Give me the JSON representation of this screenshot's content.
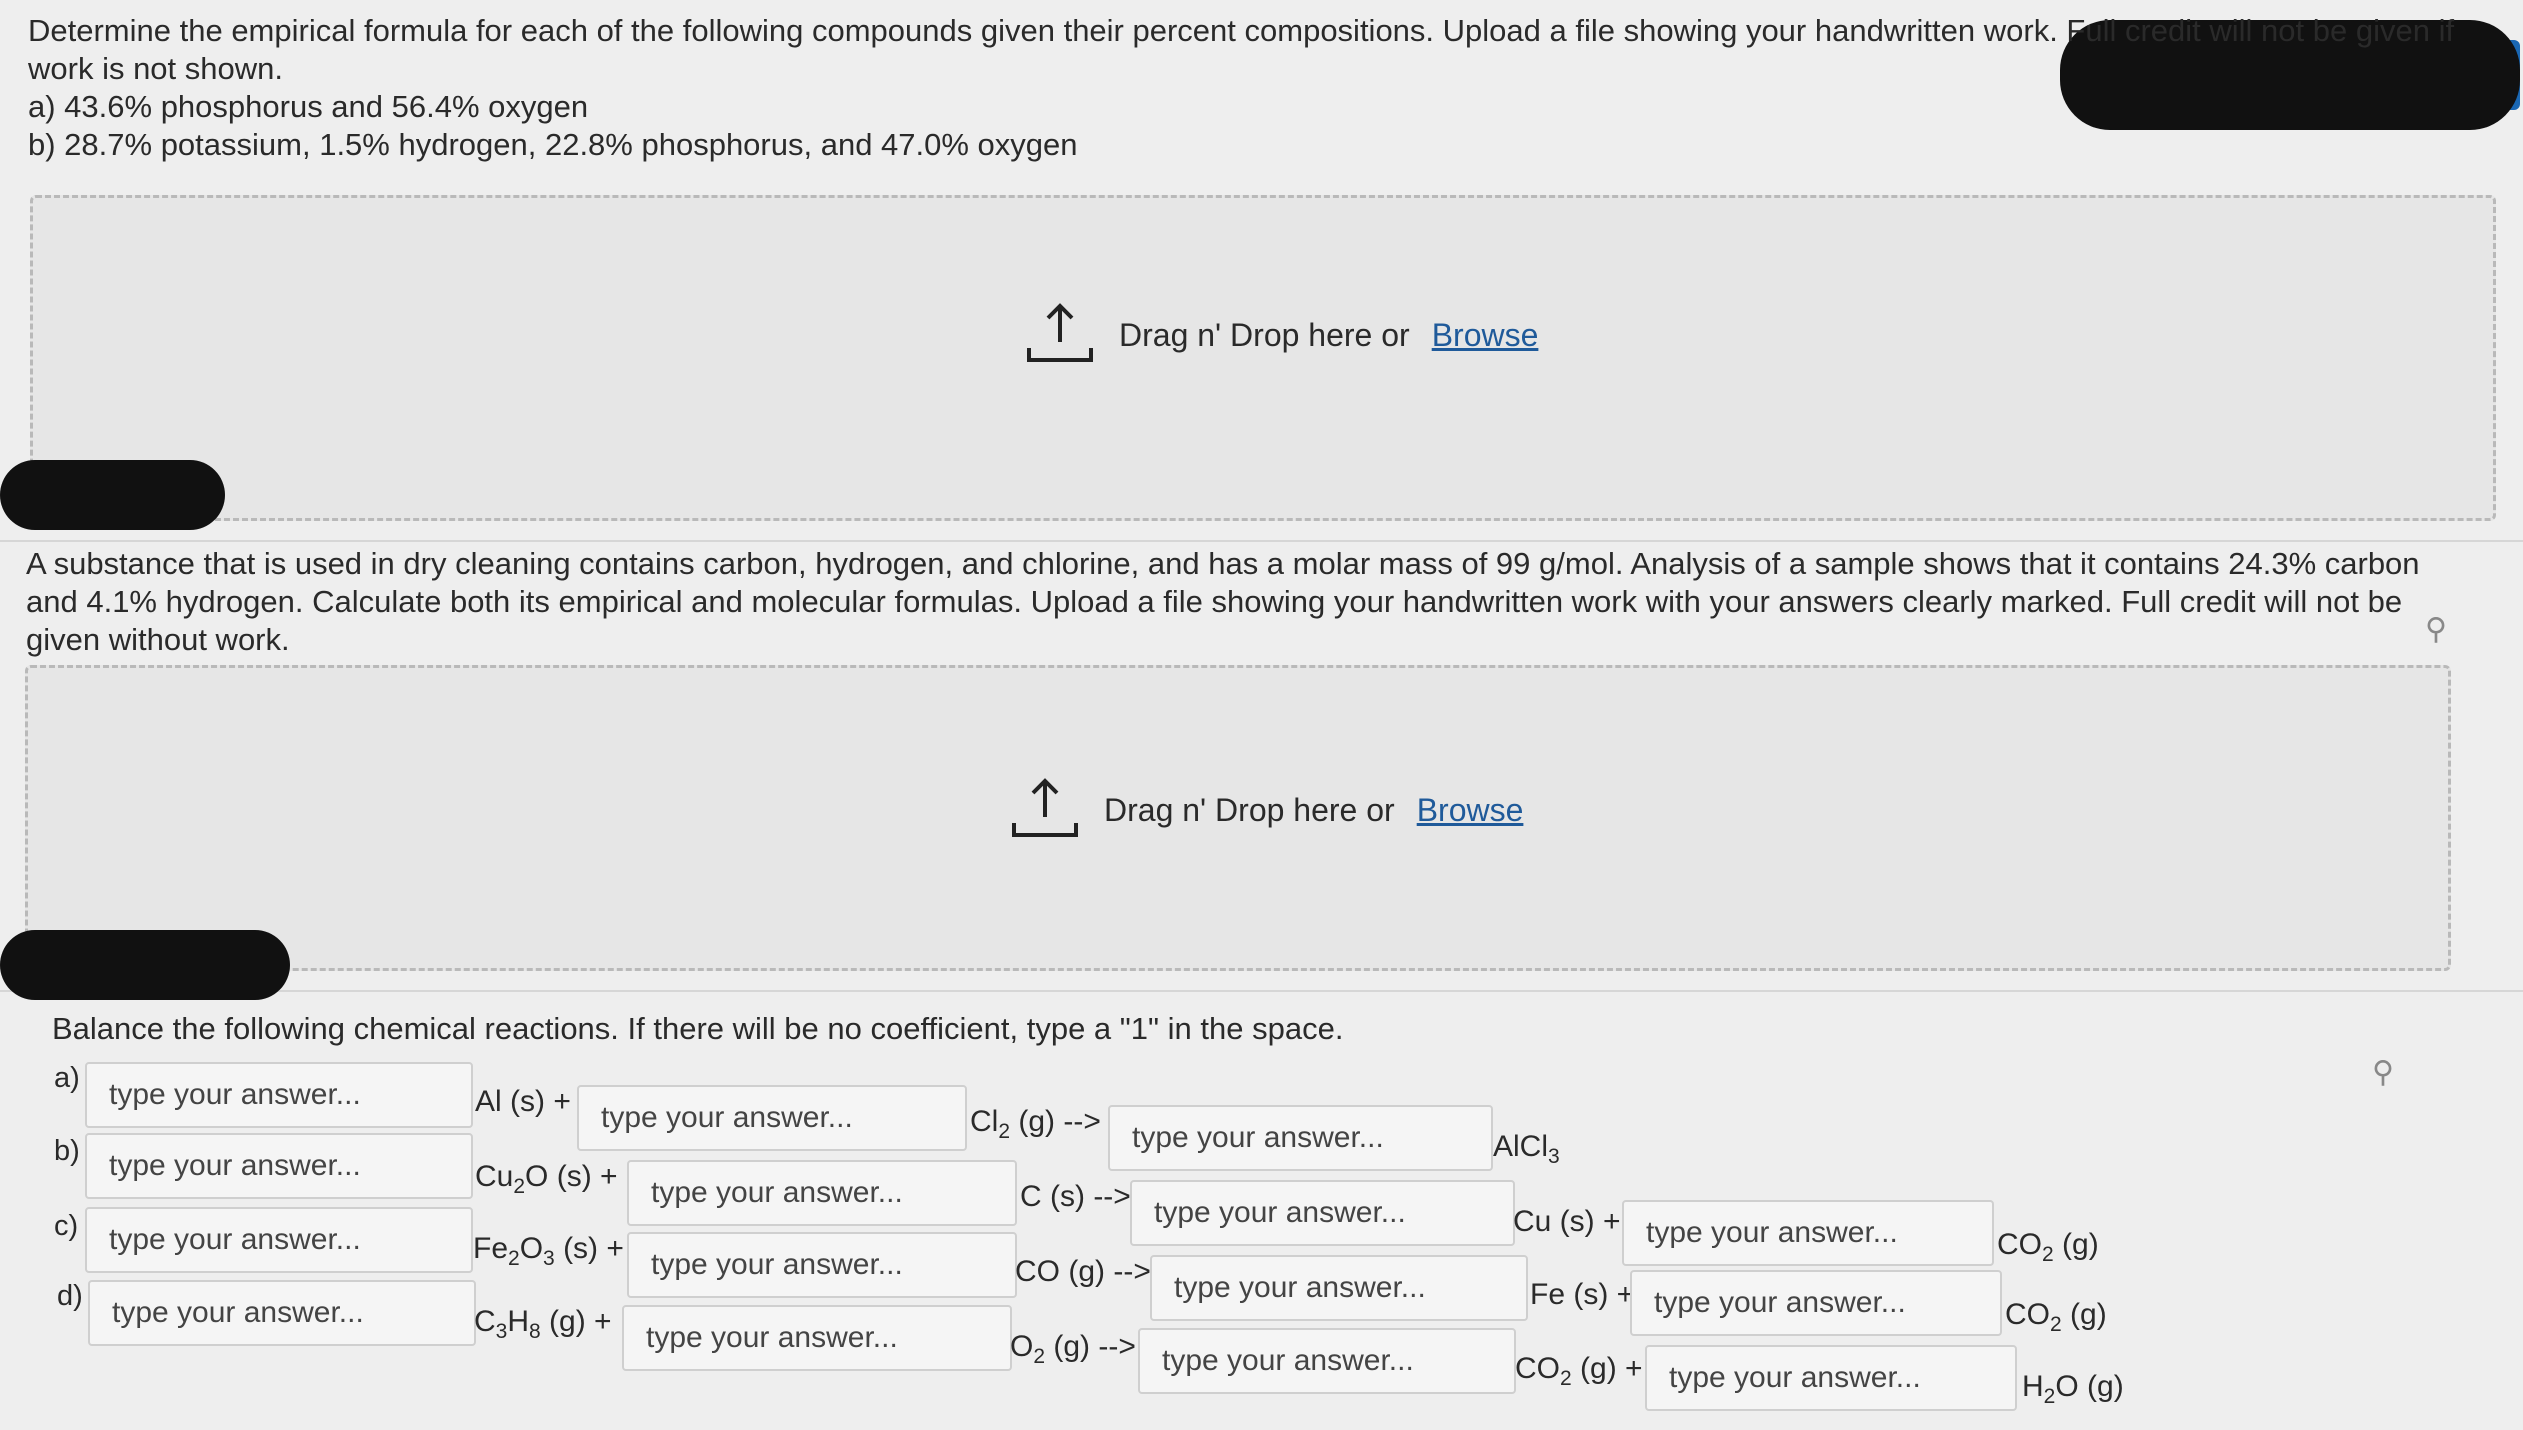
{
  "q1": {
    "instructions": "Determine the empirical formula for each of the following compounds given their percent compositions. Upload a file showing your handwritten work. Full credit will not be given if work is not shown.",
    "item_a": "a) 43.6% phosphorus and 56.4% oxygen",
    "item_b": "b) 28.7% potassium, 1.5% hydrogen, 22.8% phosphorus, and 47.0% oxygen",
    "dropzone": {
      "text": "Drag n' Drop here or",
      "browse": "Browse"
    }
  },
  "q2": {
    "text": "A substance that is used in dry cleaning contains carbon, hydrogen, and chlorine, and has a molar mass of 99 g/mol. Analysis of a sample shows that it contains 24.3% carbon and 4.1% hydrogen. Calculate both its empirical and molecular formulas. Upload a file showing your handwritten work with your answers clearly marked. Full credit will not be given without work.",
    "dropzone": {
      "text": "Drag n' Drop here or",
      "browse": "Browse"
    }
  },
  "q3": {
    "instructions": "Balance the following chemical reactions.  If there will be no coefficient, type a \"1\" in the space.",
    "placeholder": "type your answer...",
    "rows": [
      {
        "label": "a)",
        "t1": "Al (s) +",
        "t2": "Cl",
        "t2sub": "2",
        "t2rest": " (g) -->",
        "t3": "AlCl",
        "t3sub": "3"
      },
      {
        "label": "b)",
        "t1a": "Cu",
        "t1sub": "2",
        "t1b": "O (s) +",
        "t2": "C (s) -->",
        "t3": "Cu (s) +",
        "t4a": "CO",
        "t4sub": "2",
        "t4b": " (g)"
      },
      {
        "label": "c)",
        "t1a": "Fe",
        "t1sub": "2",
        "t1b": "O",
        "t1sub2": "3",
        "t1c": " (s) +",
        "t2": "CO (g) -->",
        "t3": "Fe (s) +",
        "t4a": "CO",
        "t4sub": "2",
        "t4b": " (g)"
      },
      {
        "label": "d)",
        "t1a": "C",
        "t1sub": "3",
        "t1b": "H",
        "t1sub2": "8",
        "t1c": " (g) +",
        "t2a": "O",
        "t2sub": "2",
        "t2b": " (g) -->",
        "t3a": "CO",
        "t3sub": "2",
        "t3b": " (g) +",
        "t4a": "H",
        "t4sub": "2",
        "t4b": "O (g)"
      }
    ]
  },
  "colors": {
    "accent": "#1a67b3",
    "link": "#1f5a9a",
    "background": "#eeeeee"
  },
  "icons": [
    "upload-arrow-icon",
    "pin-icon"
  ]
}
